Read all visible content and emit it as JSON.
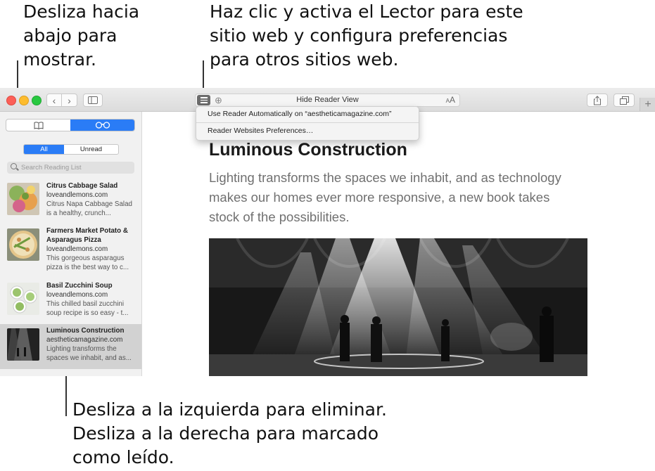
{
  "callouts": {
    "left": "Desliza hacia\nabajo para\nmostrar.",
    "top": "Haz clic y activa el Lector para este\nsitio web y configura preferencias\npara otros sitios web.",
    "bottom": "Desliza a la izquierda para eliminar.\nDesliza a la derecha para marcado\ncomo leído."
  },
  "toolbar": {
    "address_text": "Hide Reader View",
    "text_size_label": "AA"
  },
  "reader_menu": {
    "auto_label": "Use Reader Automatically on “aestheticamagazine.com”",
    "prefs_label": "Reader Websites Preferences…"
  },
  "sidebar": {
    "segments": [
      "bookmarks-icon",
      "reading-list-icon"
    ],
    "filter": {
      "all": "All",
      "unread": "Unread"
    },
    "search_placeholder": "Search Reading List",
    "items": [
      {
        "title": "Citrus Cabbage Salad",
        "site": "loveandlemons.com",
        "snippet": "Citrus Napa Cabbage Salad is a healthy, crunch..."
      },
      {
        "title": "Farmers Market Potato & Asparagus Pizza",
        "site": "loveandlemons.com",
        "snippet": "This gorgeous asparagus pizza is the best way to c..."
      },
      {
        "title": "Basil Zucchini Soup",
        "site": "loveandlemons.com",
        "snippet": "This chilled basil zucchini soup recipe is so easy - t..."
      },
      {
        "title": "Luminous Construction",
        "site": "aestheticamagazine.com",
        "snippet": "Lighting transforms the spaces we inhabit, and as..."
      }
    ]
  },
  "article": {
    "title": "Luminous Construction",
    "subtitle": "Lighting transforms the spaces we inhabit, and as technology makes our homes ever more responsive, a new book takes stock of the possibilities."
  }
}
